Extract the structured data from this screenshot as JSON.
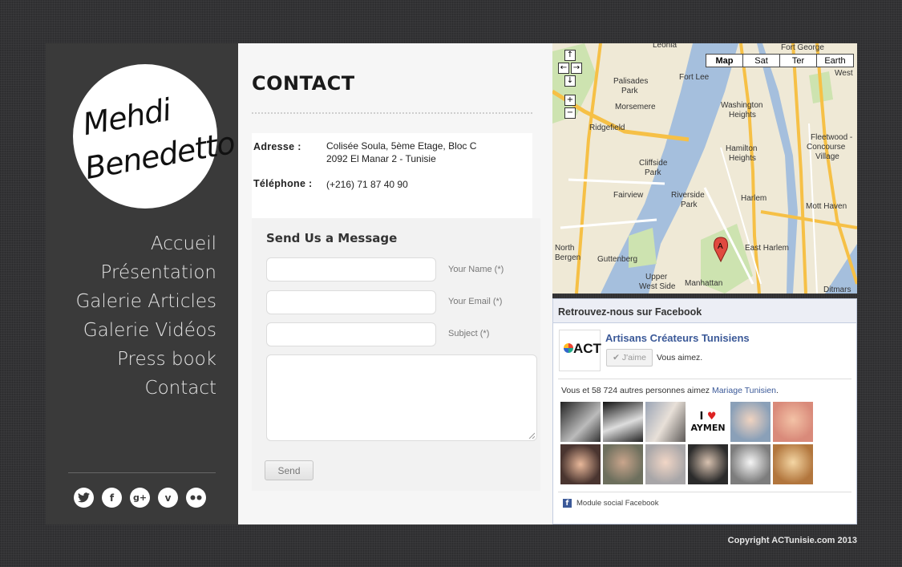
{
  "logo": {
    "line1": "Mehdi",
    "line2": "Benedetto"
  },
  "nav": [
    {
      "label": "Accueil"
    },
    {
      "label": "Présentation"
    },
    {
      "label": "Galerie Articles"
    },
    {
      "label": "Galerie Vidéos"
    },
    {
      "label": "Press book"
    },
    {
      "label": "Contact"
    }
  ],
  "social": {
    "twitter": "twitter-icon",
    "facebook": "facebook-icon",
    "googleplus": "google-plus-icon",
    "vimeo": "vimeo-icon",
    "flickr": "flickr-icon"
  },
  "page": {
    "title": "CONTACT"
  },
  "contact": {
    "address_label": "Adresse :",
    "address_line1": "Colisée Soula, 5ème Etage, Bloc C",
    "address_line2": "2092 El Manar 2 - Tunisie",
    "phone_label": "Téléphone :",
    "phone": "(+216) 71 87 40 90"
  },
  "form": {
    "title": "Send Us a Message",
    "name_label": "Your Name (*)",
    "email_label": "Your Email (*)",
    "subject_label": "Subject (*)",
    "send": "Send"
  },
  "map": {
    "types": [
      "Map",
      "Sat",
      "Ter",
      "Earth"
    ],
    "active_type": "Map",
    "labels": [
      "Leonia",
      "Fort George",
      "Fort Lee",
      "Palisades Park",
      "Morsemere",
      "Ridgefield",
      "Cliffside Park",
      "Fairview",
      "Washington Heights",
      "Hamilton Heights",
      "Fleetwood - Concourse Village",
      "Riverside Park",
      "Harlem",
      "Mott Haven",
      "East Harlem",
      "North Bergen",
      "Guttenberg",
      "Upper West Side",
      "Manhattan",
      "Ditmars",
      "West"
    ],
    "marker": "A"
  },
  "facebook": {
    "header": "Retrouvez-nous sur Facebook",
    "page_name": "Artisans Créateurs Tunisiens",
    "logo_text": "ACT",
    "like_label": "J'aime",
    "you_like": "Vous aimez.",
    "count_text": "Vous et 58 724 autres personnes aimez ",
    "count_link": "Mariage Tunisien",
    "count_end": ".",
    "footer": "Module social Facebook"
  },
  "footer": {
    "copyright": "Copyright ACTunisie.com 2013"
  }
}
